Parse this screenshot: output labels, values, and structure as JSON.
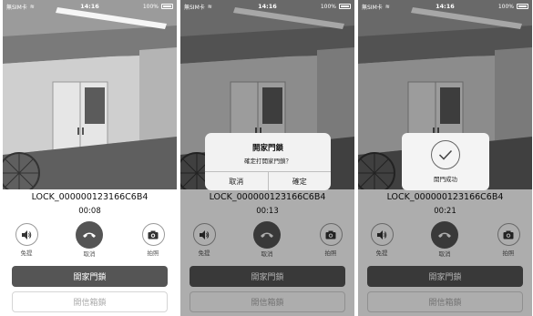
{
  "screens": [
    {
      "status": {
        "carrier": "無SIM卡",
        "time": "14:16",
        "battery": "100%"
      },
      "device_id": "LOCK_000000123166C6B4",
      "timer": "00:08",
      "controls": {
        "speaker": "免提",
        "hangup": "取消",
        "snapshot": "拍照"
      },
      "open_door": "開家門鎖",
      "open_mailbox": "開信箱鎖"
    },
    {
      "status": {
        "carrier": "無SIM卡",
        "time": "14:16",
        "battery": "100%"
      },
      "device_id": "LOCK_000000123166C6B4",
      "timer": "00:13",
      "controls": {
        "speaker": "免提",
        "hangup": "取消",
        "snapshot": "拍照"
      },
      "open_door": "開家門鎖",
      "open_mailbox": "開信箱鎖",
      "dialog": {
        "title": "開家門鎖",
        "message": "確定打開家門鎖？",
        "cancel": "取消",
        "confirm": "確定"
      }
    },
    {
      "status": {
        "carrier": "無SIM卡",
        "time": "14:16",
        "battery": "100%"
      },
      "device_id": "LOCK_000000123166C6B4",
      "timer": "00:21",
      "controls": {
        "speaker": "免提",
        "hangup": "取消",
        "snapshot": "拍照"
      },
      "open_door": "開家門鎖",
      "open_mailbox": "開信箱鎖",
      "toast": {
        "message": "開門成功"
      }
    }
  ],
  "icons": {
    "speaker": "speaker-icon",
    "hangup": "phone-hangup-icon",
    "snapshot": "camera-icon",
    "check": "checkmark-icon"
  },
  "colors": {
    "primary_button": "#555555",
    "dim_overlay": "rgba(0,0,0,0.32)"
  }
}
